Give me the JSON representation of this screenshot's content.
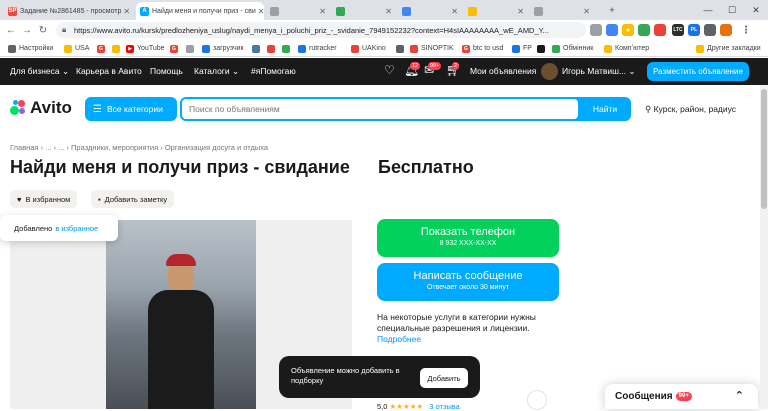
{
  "browser": {
    "tabs": [
      {
        "title": "Задание №2861485 - просмотр",
        "favicon": "SP",
        "color": "#e74c3c"
      },
      {
        "title": "Найди меня и получи приз - сви",
        "favicon": "A",
        "color": "#00aaff",
        "active": true
      },
      {
        "title": "",
        "favicon": "",
        "color": "#9aa0a6"
      },
      {
        "title": "",
        "favicon": "",
        "color": "#34a853"
      },
      {
        "title": "",
        "favicon": "",
        "color": "#4285f4"
      },
      {
        "title": "",
        "favicon": "",
        "color": "#fbbc04"
      },
      {
        "title": "",
        "favicon": "",
        "color": "#9aa0a6"
      }
    ],
    "url": "https://www.avito.ru/kursk/predlozheniya_uslug/naydi_menya_i_poluchi_priz_-_svidanie_7949152232?context=H4sIAAAAAAAA_wE_AMD_Y...",
    "bookmarks": [
      "Настройки",
      "USA",
      "",
      "YouTube",
      "",
      "",
      "загрузчик",
      "",
      "",
      "",
      "rutracker",
      "UAKino",
      "",
      "SINOPTIK",
      "btc to usd",
      "FP",
      "",
      "Обмінник",
      "Компʼютер",
      "Другие закладки"
    ],
    "ext_labels": [
      "LTC",
      "PL"
    ]
  },
  "header": {
    "links": [
      "Для бизнеса ⌄",
      "Карьера в Авито",
      "Помощь",
      "Каталоги ⌄",
      "#яПомогаю"
    ],
    "badges": [
      "12",
      "99+",
      "2"
    ],
    "my_listings": "Мои объявления",
    "user_name": "Игорь Матвиш... ⌄",
    "post_button": "Разместить объявление"
  },
  "search": {
    "logo": "Avito",
    "categories_button": "Все категории",
    "placeholder": "Поиск по объявлениям",
    "find_button": "Найти",
    "location": "Курск, район, радиус"
  },
  "listing": {
    "breadcrumb": "Главная  ›  ...  ›  ...  ›  Праздники, мероприятия  ›  Организация досуга и отдыха",
    "title": "Найди меня и получи приз - свидание",
    "price": "Бесплатно",
    "favorite_button": "В избранном",
    "note_button": "Добавить заметку",
    "fav_toast_text": "Добавлено",
    "fav_toast_link": "в избранное",
    "phone_button": "Показать телефон",
    "phone_masked": "8 932 XXX-XX-XX",
    "message_button": "Написать сообщение",
    "message_sub": "Отвечает около 30 минут",
    "note_text": "На некоторые услуги в категории нужны специальные разрешения и лицензии.",
    "note_more": "Подробнее",
    "rating": "5,0",
    "stars": "★★★★★",
    "reviews": "3 отзыва"
  },
  "snackbar": {
    "text": "Объявление можно добавить в подборку",
    "button": "Добавить"
  },
  "messages": {
    "label": "Сообщения",
    "count": "99+"
  },
  "colors": {
    "brand_blue": "#00aaff",
    "green": "#02d15c",
    "dark": "#1a1a1a",
    "badge_red": "#ff4053"
  }
}
